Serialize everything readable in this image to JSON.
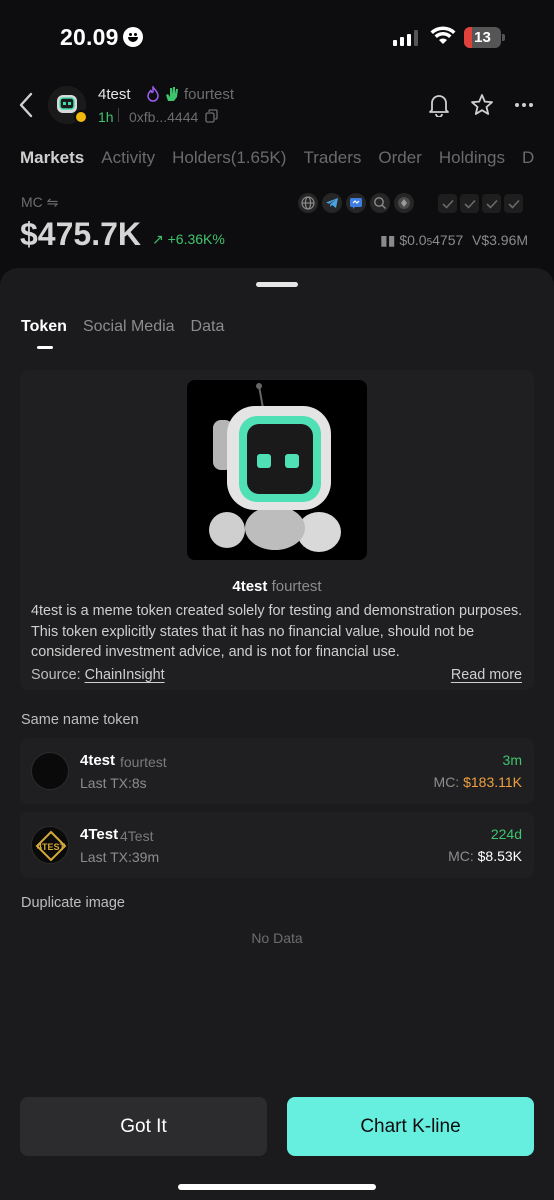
{
  "status_bar": {
    "time": "20.09",
    "battery": "13"
  },
  "header": {
    "token_symbol": "4test",
    "token_name": "fourtest",
    "age": "1h",
    "address": "0xfb...4444"
  },
  "nav_tabs": [
    "Markets",
    "Activity",
    "Holders(1.65K)",
    "Traders",
    "Order",
    "Holdings",
    "D"
  ],
  "market": {
    "mc_label": "MC ⇋",
    "mc_value": "$475.7K",
    "change": "+6.36K%",
    "price_prefix": "$0.0",
    "price_zeros": "5",
    "price_digits": "4757",
    "volume_prefix": "V",
    "volume": "$3.96M"
  },
  "sheet": {
    "tabs": [
      "Token",
      "Social Media",
      "Data"
    ],
    "token_card": {
      "symbol": "4test",
      "name": "fourtest",
      "description": "4test is a meme token created solely for testing and demonstration purposes. This token explicitly states that it has no financial value, should not be considered investment advice, and is not for financial use.",
      "source_label": "Source:",
      "source_link": "ChainInsight",
      "read_more": "Read more"
    },
    "same_name_label": "Same name token",
    "same_name_tokens": [
      {
        "symbol": "4test",
        "name": "fourtest",
        "last_tx": "Last TX:8s",
        "age": "3m",
        "mc_label": "MC:",
        "mc": "$183.11K",
        "mc_color": "#f0a040"
      },
      {
        "symbol": "4Test",
        "name": "4Test",
        "last_tx": "Last TX:39m",
        "age": "224d",
        "mc_label": "MC:",
        "mc": "$8.53K",
        "mc_color": "#ffffff"
      }
    ],
    "duplicate_label": "Duplicate image",
    "no_data": "No Data",
    "buttons": {
      "got_it": "Got It",
      "chart": "Chart K-line"
    }
  },
  "colors": {
    "accent": "#66efdf",
    "up": "#3ec46d",
    "bg": "#0d0d0f",
    "sheet": "#1b1b1d"
  }
}
